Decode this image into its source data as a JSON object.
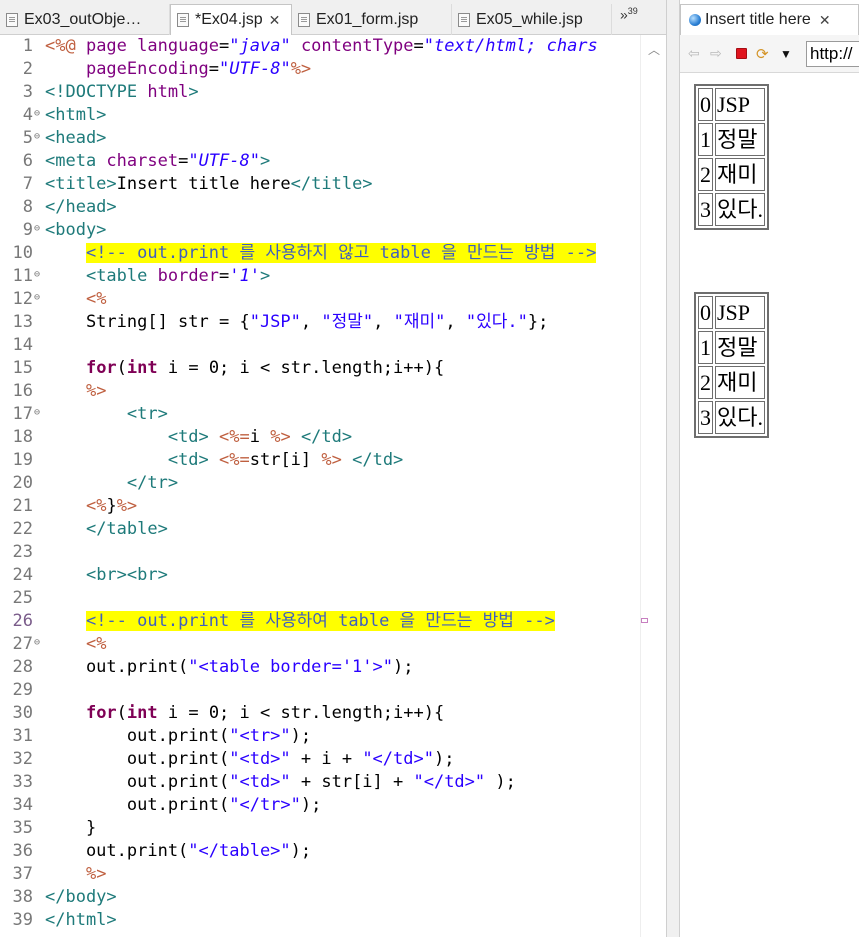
{
  "editor": {
    "tabs": [
      {
        "label": "Ex03_outObje…",
        "active": false,
        "has_close": false
      },
      {
        "label": "*Ex04.jsp",
        "active": true,
        "has_close": true
      },
      {
        "label": "Ex01_form.jsp",
        "active": false,
        "has_close": false
      },
      {
        "label": "Ex05_while.jsp",
        "active": false,
        "has_close": false
      }
    ],
    "overflow_label": "»",
    "overflow_count": "39",
    "lines": [
      {
        "n": "1",
        "fold": "",
        "segs": [
          [
            "d",
            "<%@ "
          ],
          [
            "k2",
            "page "
          ],
          [
            "a",
            "language"
          ],
          [
            "p",
            "="
          ],
          [
            "si",
            "\"java\" "
          ],
          [
            "a",
            "contentType"
          ],
          [
            "p",
            "="
          ],
          [
            "si",
            "\"text/html; chars"
          ]
        ]
      },
      {
        "n": "2",
        "fold": "",
        "segs": [
          [
            "p",
            "    "
          ],
          [
            "a",
            "pageEncoding"
          ],
          [
            "p",
            "="
          ],
          [
            "si",
            "\"UTF-8\""
          ],
          [
            "d",
            "%>"
          ]
        ]
      },
      {
        "n": "3",
        "fold": "",
        "segs": [
          [
            "t",
            "<!DOCTYPE "
          ],
          [
            "a",
            "html"
          ],
          [
            "t",
            ">"
          ]
        ]
      },
      {
        "n": "4",
        "fold": "⊖",
        "segs": [
          [
            "t",
            "<html>"
          ]
        ]
      },
      {
        "n": "5",
        "fold": "⊖",
        "segs": [
          [
            "t",
            "<head>"
          ]
        ]
      },
      {
        "n": "6",
        "fold": "",
        "segs": [
          [
            "t",
            "<meta "
          ],
          [
            "a",
            "charset"
          ],
          [
            "p",
            "="
          ],
          [
            "si",
            "\"UTF-8\""
          ],
          [
            "t",
            ">"
          ]
        ]
      },
      {
        "n": "7",
        "fold": "",
        "segs": [
          [
            "t",
            "<title>"
          ],
          [
            "p",
            "Insert title here"
          ],
          [
            "t",
            "</title>"
          ]
        ]
      },
      {
        "n": "8",
        "fold": "",
        "segs": [
          [
            "t",
            "</head>"
          ]
        ]
      },
      {
        "n": "9",
        "fold": "⊖",
        "segs": [
          [
            "t",
            "<body>"
          ]
        ]
      },
      {
        "n": "10",
        "fold": "",
        "hl": true,
        "segs": [
          [
            "p",
            "    "
          ],
          [
            "cm",
            "<!-- out.print 를 사용하지 않고 table 을 만드는 방법 -->"
          ]
        ]
      },
      {
        "n": "11",
        "fold": "⊖",
        "segs": [
          [
            "p",
            "    "
          ],
          [
            "t",
            "<table "
          ],
          [
            "a",
            "border"
          ],
          [
            "p",
            "="
          ],
          [
            "si",
            "'1'"
          ],
          [
            "t",
            ">"
          ]
        ]
      },
      {
        "n": "12",
        "fold": "⊖",
        "segs": [
          [
            "p",
            "    "
          ],
          [
            "d",
            "<%"
          ]
        ]
      },
      {
        "n": "13",
        "fold": "",
        "segs": [
          [
            "p",
            "    String[] str = {"
          ],
          [
            "s",
            "\"JSP\""
          ],
          [
            "p",
            ", "
          ],
          [
            "s",
            "\"정말\""
          ],
          [
            "p",
            ", "
          ],
          [
            "s",
            "\"재미\""
          ],
          [
            "p",
            ", "
          ],
          [
            "s",
            "\"있다.\""
          ],
          [
            "p",
            "};"
          ]
        ]
      },
      {
        "n": "14",
        "fold": "",
        "segs": [
          [
            "p",
            ""
          ]
        ]
      },
      {
        "n": "15",
        "fold": "",
        "segs": [
          [
            "p",
            "    "
          ],
          [
            "k",
            "for"
          ],
          [
            "p",
            "("
          ],
          [
            "k",
            "int"
          ],
          [
            "p",
            " i = 0; i < str.length;i++){"
          ]
        ]
      },
      {
        "n": "16",
        "fold": "",
        "segs": [
          [
            "p",
            "    "
          ],
          [
            "d",
            "%>"
          ]
        ]
      },
      {
        "n": "17",
        "fold": "⊖",
        "segs": [
          [
            "p",
            "        "
          ],
          [
            "t",
            "<tr>"
          ]
        ]
      },
      {
        "n": "18",
        "fold": "",
        "segs": [
          [
            "p",
            "            "
          ],
          [
            "t",
            "<td> "
          ],
          [
            "d",
            "<%="
          ],
          [
            "p",
            "i "
          ],
          [
            "d",
            "%>"
          ],
          [
            "t",
            " </td>"
          ]
        ]
      },
      {
        "n": "19",
        "fold": "",
        "segs": [
          [
            "p",
            "            "
          ],
          [
            "t",
            "<td> "
          ],
          [
            "d",
            "<%="
          ],
          [
            "p",
            "str[i] "
          ],
          [
            "d",
            "%>"
          ],
          [
            "t",
            " </td>"
          ]
        ]
      },
      {
        "n": "20",
        "fold": "",
        "segs": [
          [
            "p",
            "        "
          ],
          [
            "t",
            "</tr>"
          ]
        ]
      },
      {
        "n": "21",
        "fold": "",
        "segs": [
          [
            "p",
            "    "
          ],
          [
            "d",
            "<%"
          ],
          [
            "p",
            "}"
          ],
          [
            "d",
            "%>"
          ]
        ]
      },
      {
        "n": "22",
        "fold": "",
        "segs": [
          [
            "p",
            "    "
          ],
          [
            "t",
            "</table>"
          ]
        ]
      },
      {
        "n": "23",
        "fold": "",
        "segs": [
          [
            "p",
            ""
          ]
        ]
      },
      {
        "n": "24",
        "fold": "",
        "segs": [
          [
            "p",
            "    "
          ],
          [
            "t",
            "<br><br>"
          ]
        ]
      },
      {
        "n": "25",
        "fold": "",
        "segs": [
          [
            "p",
            ""
          ]
        ]
      },
      {
        "n": "26",
        "fold": "",
        "hl": true,
        "segs": [
          [
            "p",
            "    "
          ],
          [
            "cm",
            "<!-- out.print 를 사용하여 table 을 만드는 방법 -->"
          ]
        ]
      },
      {
        "n": "27",
        "fold": "⊖",
        "segs": [
          [
            "p",
            "    "
          ],
          [
            "d",
            "<%"
          ]
        ]
      },
      {
        "n": "28",
        "fold": "",
        "segs": [
          [
            "p",
            "    out.print("
          ],
          [
            "s",
            "\"<table border='1'>\""
          ],
          [
            "p",
            ");"
          ]
        ]
      },
      {
        "n": "29",
        "fold": "",
        "segs": [
          [
            "p",
            ""
          ]
        ]
      },
      {
        "n": "30",
        "fold": "",
        "segs": [
          [
            "p",
            "    "
          ],
          [
            "k",
            "for"
          ],
          [
            "p",
            "("
          ],
          [
            "k",
            "int"
          ],
          [
            "p",
            " i = 0; i < str.length;i++){"
          ]
        ]
      },
      {
        "n": "31",
        "fold": "",
        "segs": [
          [
            "p",
            "        out.print("
          ],
          [
            "s",
            "\"<tr>\""
          ],
          [
            "p",
            ");"
          ]
        ]
      },
      {
        "n": "32",
        "fold": "",
        "segs": [
          [
            "p",
            "        out.print("
          ],
          [
            "s",
            "\"<td>\""
          ],
          [
            "p",
            " + i + "
          ],
          [
            "s",
            "\"</td>\""
          ],
          [
            "p",
            ");"
          ]
        ]
      },
      {
        "n": "33",
        "fold": "",
        "segs": [
          [
            "p",
            "        out.print("
          ],
          [
            "s",
            "\"<td>\""
          ],
          [
            "p",
            " + str[i] + "
          ],
          [
            "s",
            "\"</td>\""
          ],
          [
            "p",
            " );"
          ]
        ]
      },
      {
        "n": "34",
        "fold": "",
        "segs": [
          [
            "p",
            "        out.print("
          ],
          [
            "s",
            "\"</tr>\""
          ],
          [
            "p",
            ");"
          ]
        ]
      },
      {
        "n": "35",
        "fold": "",
        "segs": [
          [
            "p",
            "    }"
          ]
        ]
      },
      {
        "n": "36",
        "fold": "",
        "segs": [
          [
            "p",
            "    out.print("
          ],
          [
            "s",
            "\"</table>\""
          ],
          [
            "p",
            ");"
          ]
        ]
      },
      {
        "n": "37",
        "fold": "",
        "segs": [
          [
            "p",
            "    "
          ],
          [
            "d",
            "%>"
          ]
        ]
      },
      {
        "n": "38",
        "fold": "",
        "segs": [
          [
            "t",
            "</body>"
          ]
        ]
      },
      {
        "n": "39",
        "fold": "",
        "segs": [
          [
            "t",
            "</html>"
          ]
        ]
      }
    ]
  },
  "browser": {
    "tab_title": "Insert title here",
    "url": "http://",
    "tables": [
      {
        "rows": [
          [
            "0",
            "JSP"
          ],
          [
            "1",
            "정말"
          ],
          [
            "2",
            "재미"
          ],
          [
            "3",
            "있다."
          ]
        ]
      },
      {
        "rows": [
          [
            "0",
            "JSP"
          ],
          [
            "1",
            "정말"
          ],
          [
            "2",
            "재미"
          ],
          [
            "3",
            "있다."
          ]
        ]
      }
    ]
  },
  "colors": {
    "highlight": "#ffff00",
    "tag": "#1e7a7a",
    "attribute": "#7f007f",
    "string": "#2a00ff",
    "keyword": "#7f0055",
    "jsp_delimiter": "#bf5f3f",
    "comment": "#3f5fbf"
  }
}
